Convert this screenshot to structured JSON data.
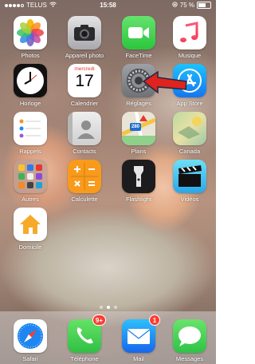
{
  "status": {
    "carrier": "TELUS",
    "time": "15:58",
    "battery": "75 %",
    "battery_level": 0.75
  },
  "apps": {
    "photos": "Photos",
    "camera": "Appareil photo",
    "facetime": "FaceTime",
    "music": "Musique",
    "clock": "Horloge",
    "calendar": "Calendrier",
    "calendar_day": "mercredi",
    "calendar_date": "17",
    "settings": "Réglages",
    "appstore": "App Store",
    "reminders": "Rappels",
    "contacts": "Contacts",
    "maps": "Plans",
    "maps_shield": "280",
    "canada": "Canada",
    "others": "Autres",
    "calculator": "Calculette",
    "flashlight": "Flashlight",
    "videos": "Vidéos",
    "home": "Domicile"
  },
  "dock": {
    "safari": "Safari",
    "phone": "Téléphone",
    "phone_badge": "9+",
    "mail": "Mail",
    "mail_badge": "1",
    "messages": "Messages"
  },
  "colors": {
    "arrow": "#e0231c",
    "badge": "#ff3b30"
  }
}
